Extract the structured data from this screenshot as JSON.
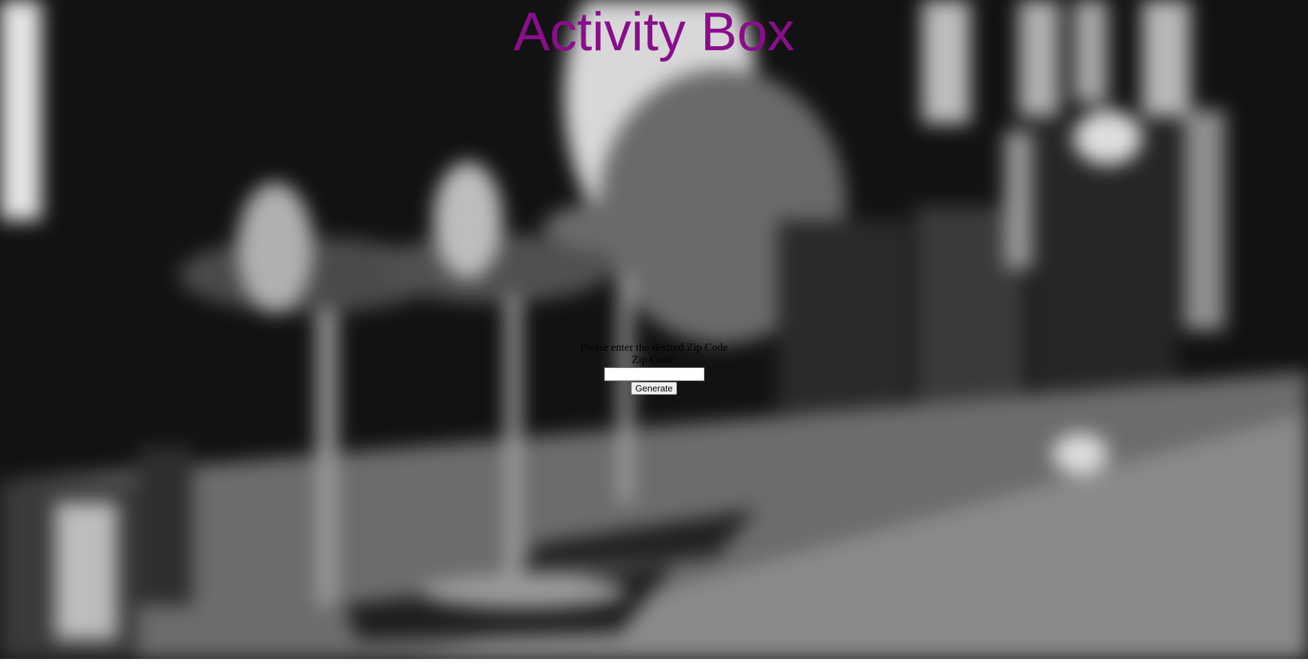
{
  "header": {
    "title": "Activity Box"
  },
  "form": {
    "prompt": "Please enter the desired Zip Code",
    "zip_label": "Zip Code:",
    "zip_value": "",
    "zip_placeholder": "",
    "submit_label": "Generate"
  },
  "background": {
    "description_icon": "blurred-cocktail-glasses-photo"
  },
  "colors": {
    "title": "#8a0e8c"
  }
}
